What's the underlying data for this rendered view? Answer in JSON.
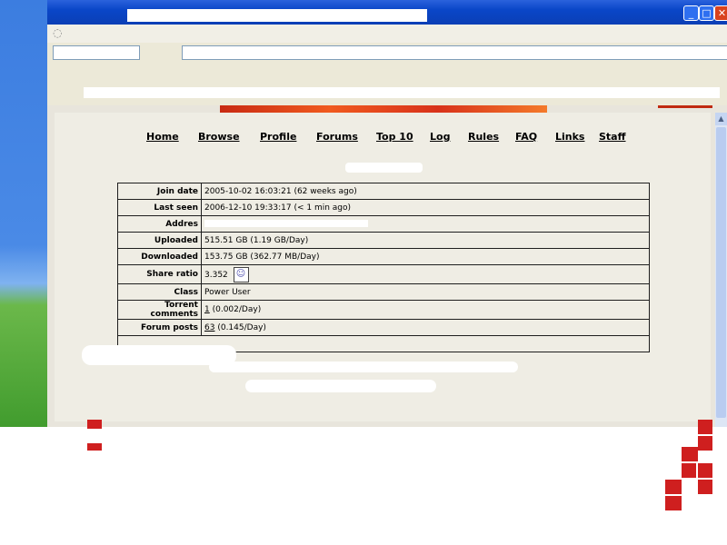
{
  "window": {
    "min_label": "_",
    "max_label": "□",
    "close_label": "✕"
  },
  "nav": {
    "items": [
      {
        "label": "Home"
      },
      {
        "label": "Browse"
      },
      {
        "label": "Profile"
      },
      {
        "label": "Forums"
      },
      {
        "label": "Top 10"
      },
      {
        "label": "Log"
      },
      {
        "label": "Rules"
      },
      {
        "label": "FAQ"
      },
      {
        "label": "Links"
      },
      {
        "label": "Staff"
      }
    ]
  },
  "details": {
    "join_date": {
      "label": "Join date",
      "value": "2005-10-02 16:03:21 (62 weeks ago)"
    },
    "last_seen": {
      "label": "Last seen",
      "value": "2006-12-10 19:33:17 (< 1 min ago)"
    },
    "address": {
      "label": "Addres"
    },
    "uploaded": {
      "label": "Uploaded",
      "value": "515.51 GB (1.19 GB/Day)"
    },
    "downloaded": {
      "label": "Downloaded",
      "value": "153.75 GB (362.77 MB/Day)"
    },
    "share_ratio": {
      "label": "Share ratio",
      "value": "3.352"
    },
    "class": {
      "label": "Class",
      "value": "Power User"
    },
    "torrent_comments": {
      "label": "Torrent comments",
      "count": "1",
      "rate": "(0.002/Day)"
    },
    "forum_posts": {
      "label": "Forum posts",
      "count": "63",
      "rate": "(0.145/Day)"
    }
  },
  "colors": {
    "titlebar": "#0a46c8",
    "page_bg": "#efede4",
    "banner": "#e04a1a",
    "accent_red": "#cf1f1f"
  },
  "icons": {
    "throbber": "loading-throbber-icon",
    "ratio": "ratio-smiley-icon"
  }
}
